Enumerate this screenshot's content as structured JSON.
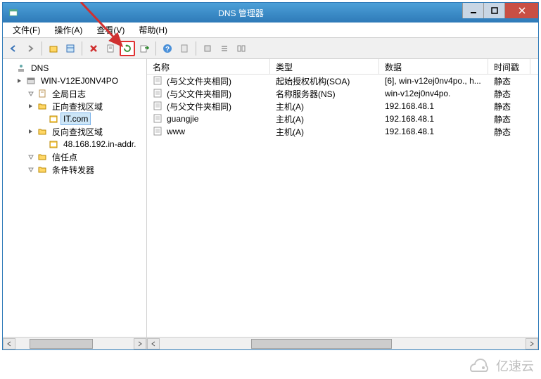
{
  "window_title": "DNS 管理器",
  "menus": [
    "文件(F)",
    "操作(A)",
    "查看(V)",
    "帮助(H)"
  ],
  "tree": {
    "root": "DNS",
    "server": "WIN-V12EJ0NV4PO",
    "nodes": [
      {
        "label": "全局日志",
        "icon": "log"
      },
      {
        "label": "正向查找区域",
        "icon": "folder",
        "children": [
          {
            "label": "IT.com",
            "icon": "zone",
            "selected": true
          }
        ]
      },
      {
        "label": "反向查找区域",
        "icon": "folder",
        "children": [
          {
            "label": "48.168.192.in-addr.",
            "icon": "zone"
          }
        ]
      },
      {
        "label": "信任点",
        "icon": "folder"
      },
      {
        "label": "条件转发器",
        "icon": "folder"
      }
    ]
  },
  "columns": [
    "名称",
    "类型",
    "数据",
    "时间戳"
  ],
  "records": [
    {
      "name": "(与父文件夹相同)",
      "type": "起始授权机构(SOA)",
      "data": "[6], win-v12ej0nv4po., h...",
      "ts": "静态"
    },
    {
      "name": "(与父文件夹相同)",
      "type": "名称服务器(NS)",
      "data": "win-v12ej0nv4po.",
      "ts": "静态"
    },
    {
      "name": "(与父文件夹相同)",
      "type": "主机(A)",
      "data": "192.168.48.1",
      "ts": "静态"
    },
    {
      "name": "guangjie",
      "type": "主机(A)",
      "data": "192.168.48.1",
      "ts": "静态"
    },
    {
      "name": "www",
      "type": "主机(A)",
      "data": "192.168.48.1",
      "ts": "静态"
    }
  ],
  "watermark": "亿速云"
}
